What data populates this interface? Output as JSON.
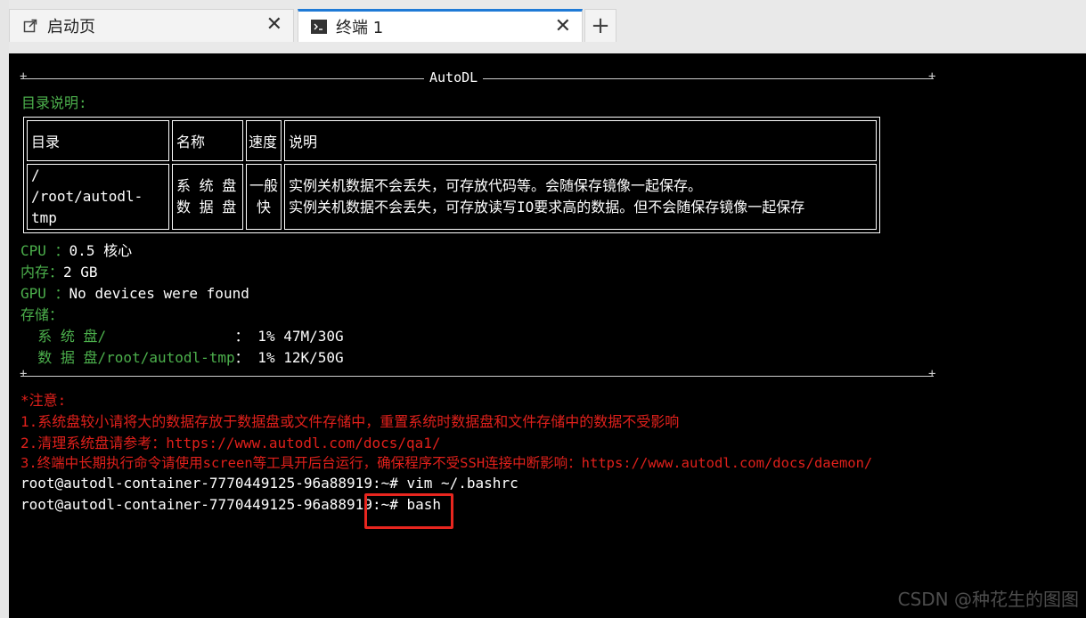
{
  "tabs": [
    {
      "label": "启动页",
      "icon": "external-link-icon",
      "close": "✕"
    },
    {
      "label": "终端 1",
      "icon": "terminal-icon",
      "close": "✕"
    }
  ],
  "add_tab": "+",
  "banner": {
    "title": "AutoDL",
    "dir_heading": "目录说明:"
  },
  "dir_table": {
    "headers": [
      "目录",
      "名称",
      "速度",
      "说明"
    ],
    "rows": [
      {
        "dir": [
          "/",
          "/root/autodl-tmp"
        ],
        "name": [
          "系 统 盘",
          "数 据 盘"
        ],
        "speed": [
          "一般",
          "快"
        ],
        "desc": [
          "实例关机数据不会丢失，可存放代码等。会随保存镜像一起保存。",
          "实例关机数据不会丢失，可存放读写IO要求高的数据。但不会随保存镜像一起保存"
        ]
      }
    ]
  },
  "info": [
    {
      "label": "CPU ：",
      "value": "0.5 核心"
    },
    {
      "label": "内存：",
      "value": "2 GB"
    },
    {
      "label": "GPU ：",
      "value": "No devices were found"
    },
    {
      "label": "存储：",
      "value": ""
    }
  ],
  "storage": [
    {
      "label": "  系 统 盘/               ",
      "value": "： 1% 47M/30G"
    },
    {
      "label": "  数 据 盘/root/autodl-tmp",
      "value": "： 1% 12K/50G"
    }
  ],
  "notes": [
    "*注意:",
    "1.系统盘较小请将大的数据存放于数据盘或文件存储中，重置系统时数据盘和文件存储中的数据不受影响",
    "2.清理系统盘请参考：https://www.autodl.com/docs/qa1/",
    "3.终端中长期执行命令请使用screen等工具开后台运行，确保程序不受SSH连接中断影响：https://www.autodl.com/docs/daemon/"
  ],
  "commands": [
    {
      "prompt": "root@autodl-container-7770449125-96a88919:~#",
      "cmd": " vim ~/.bashrc"
    },
    {
      "prompt": "root@autodl-container-7770449125-96a88919:~#",
      "cmd": " bash"
    }
  ],
  "watermark": "CSDN @种花生的图图",
  "colors": {
    "green": "#4cb04c",
    "red": "#e0201b",
    "highlight_box": "#e8261f",
    "tab_accent": "#1f7ad6"
  }
}
